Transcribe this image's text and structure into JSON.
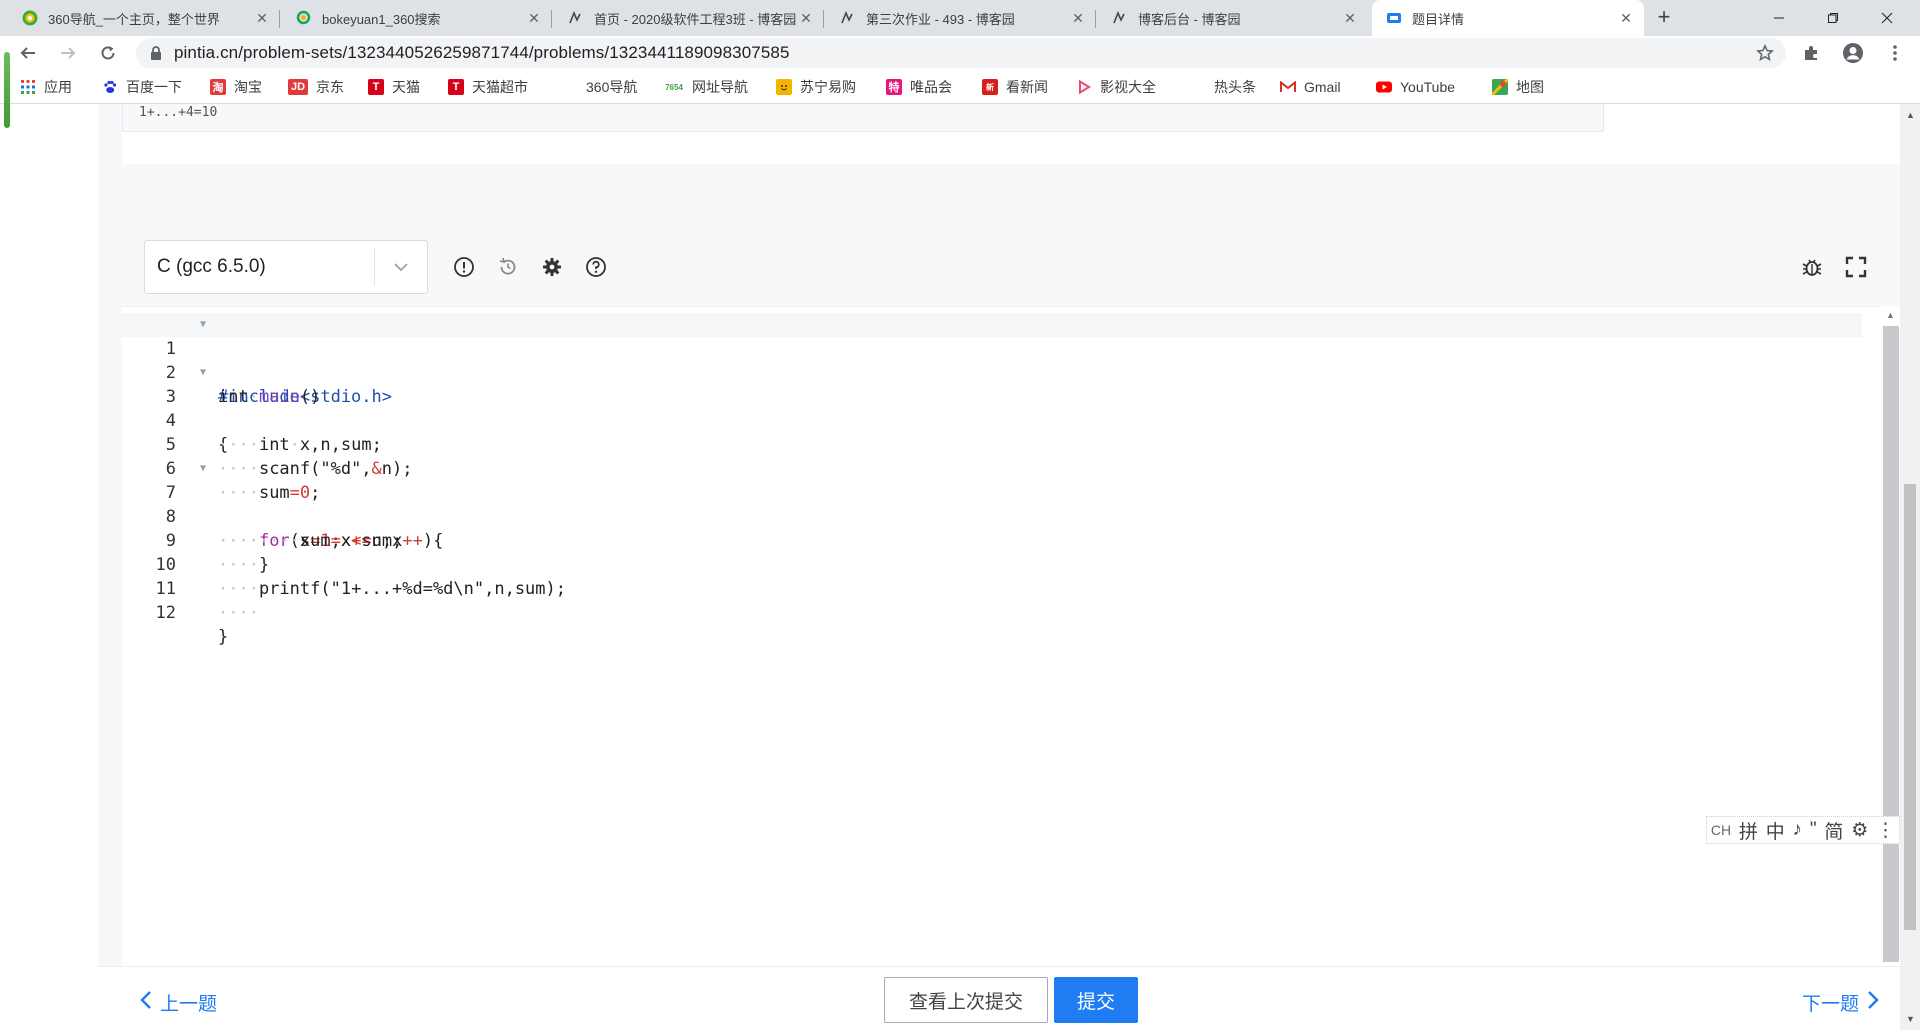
{
  "browser": {
    "tabs": [
      {
        "title": "360导航_一个主页，整个世界",
        "icon": "360-nav-icon",
        "active": false
      },
      {
        "title": "bokeyuan1_360搜索",
        "icon": "360-search-icon",
        "active": false
      },
      {
        "title": "首页 - 2020级软件工程3班 - 博客园",
        "icon": "cnblogs-icon",
        "active": false
      },
      {
        "title": "第三次作业 - 493 - 博客园",
        "icon": "cnblogs-icon",
        "active": false
      },
      {
        "title": "博客后台 - 博客园",
        "icon": "cnblogs-icon",
        "active": false
      },
      {
        "title": "题目详情",
        "icon": "pta-icon",
        "active": true
      }
    ],
    "url": "pintia.cn/problem-sets/1323440526259871744/problems/1323441189098307585",
    "bookmarks": [
      {
        "label": "应用",
        "icon": "apps-grid-icon",
        "color": "#e8453c"
      },
      {
        "label": "百度一下",
        "icon": "baidu-paw-icon",
        "color": "#2932e1"
      },
      {
        "label": "淘宝",
        "icon": "taobao-icon",
        "color": "#e4393c"
      },
      {
        "label": "京东",
        "icon": "jd-icon",
        "color": "#e4393c"
      },
      {
        "label": "天猫",
        "icon": "tmall-icon",
        "color": "#d60019"
      },
      {
        "label": "天猫超市",
        "icon": "tmall-market-icon",
        "color": "#d60019"
      },
      {
        "label": "360导航",
        "icon": "",
        "color": ""
      },
      {
        "label": "网址导航",
        "icon": "7654-icon",
        "color": "#3aa34a"
      },
      {
        "label": "苏宁易购",
        "icon": "suning-icon",
        "color": "#f4b400"
      },
      {
        "label": "唯品会",
        "icon": "vip-icon",
        "color": "#e6157a"
      },
      {
        "label": "看新闻",
        "icon": "news-icon",
        "color": "#d91d1d"
      },
      {
        "label": "影视大全",
        "icon": "video-play-icon",
        "color": "#e84c6f"
      },
      {
        "label": "热头条",
        "icon": "",
        "color": ""
      },
      {
        "label": "Gmail",
        "icon": "gmail-icon",
        "color": "#d93025"
      },
      {
        "label": "YouTube",
        "icon": "youtube-icon",
        "color": "#ff0000"
      },
      {
        "label": "地图",
        "icon": "maps-icon",
        "color": "#34a853"
      }
    ]
  },
  "problem": {
    "sample_output_tail": "1+...+4=10"
  },
  "editor": {
    "language": "C (gcc 6.5.0)",
    "toolbar_icons": [
      "exclamation-circle-icon",
      "history-icon",
      "gear-icon",
      "question-circle-icon"
    ],
    "right_icons": [
      "debug-bug-icon",
      "fullscreen-icon"
    ],
    "line_numbers": [
      "1",
      "2",
      "3",
      "4",
      "5",
      "6",
      "7",
      "8",
      "9",
      "10",
      "11",
      "12"
    ]
  },
  "ime": {
    "items": [
      "CH",
      "拼",
      "中",
      "♪",
      "\"",
      "简",
      "⚙",
      "⋮"
    ]
  },
  "footer": {
    "prev_label": "上一题",
    "next_label": "下一题",
    "history_label": "查看上次提交",
    "submit_label": "提交",
    "accent": "#1f7cf2"
  }
}
